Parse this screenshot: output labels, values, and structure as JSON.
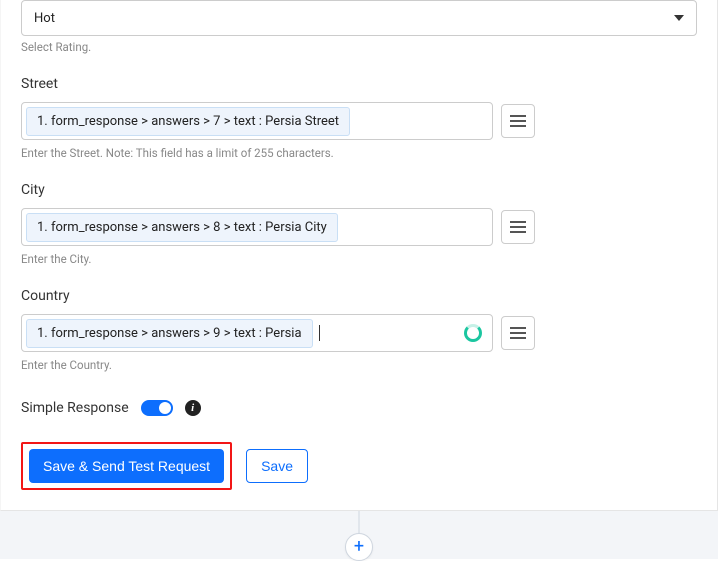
{
  "rating": {
    "value": "Hot",
    "helper": "Select Rating."
  },
  "street": {
    "label": "Street",
    "token": "1. form_response > answers > 7 > text : Persia Street",
    "helper": "Enter the Street. Note: This field has a limit of 255 characters."
  },
  "city": {
    "label": "City",
    "token": "1. form_response > answers > 8 > text : Persia City",
    "helper": "Enter the City."
  },
  "country": {
    "label": "Country",
    "token": "1. form_response > answers > 9 > text : Persia",
    "helper": "Enter the Country."
  },
  "simpleResponse": {
    "label": "Simple Response"
  },
  "buttons": {
    "saveSend": "Save & Send Test Request",
    "save": "Save"
  },
  "plus": "+"
}
